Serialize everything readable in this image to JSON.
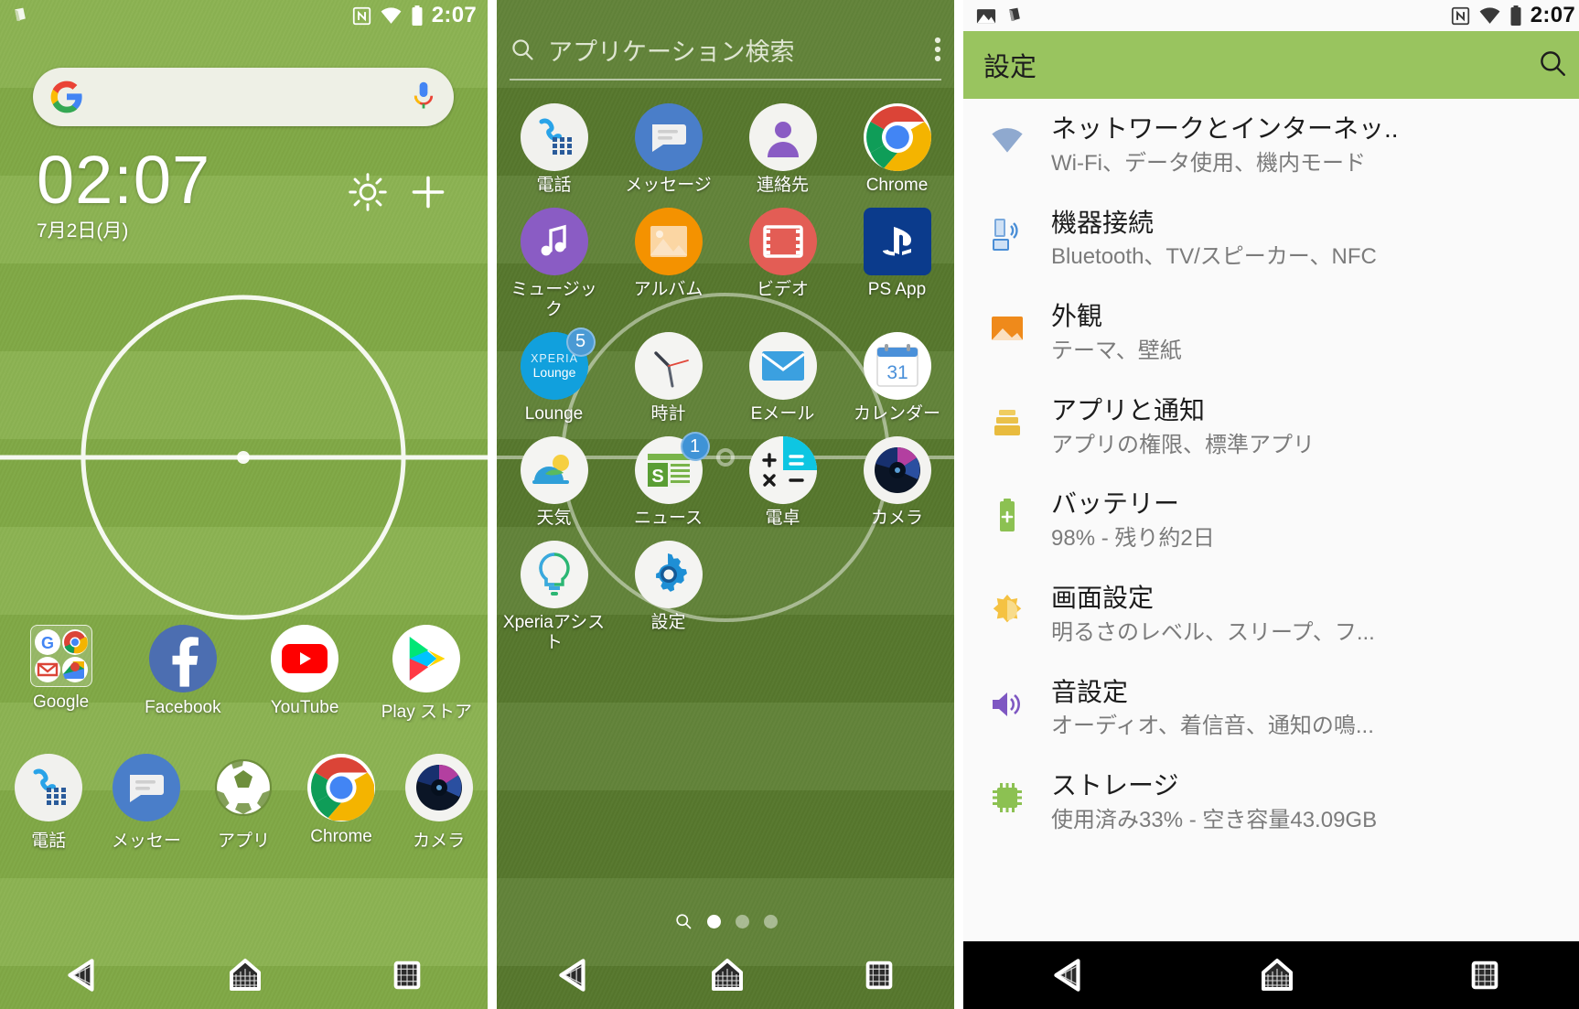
{
  "status_bar": {
    "time": "2:07",
    "icons_right": [
      "nfc-icon",
      "wifi-icon",
      "battery-icon"
    ],
    "icons_left_home": [
      "screenshot-icon"
    ],
    "icons_left_settings": [
      "image-icon",
      "screenshot-icon"
    ]
  },
  "home": {
    "search": {
      "placeholder": "",
      "logo": "google-g-icon",
      "mic": "microphone-icon"
    },
    "clock": {
      "time": "02:07",
      "date": "7月2日(月)",
      "weather_icon": "sun-icon",
      "add_icon": "plus-icon"
    },
    "apps": [
      {
        "label": "Google",
        "icon": "google-folder-icon"
      },
      {
        "label": "Facebook",
        "icon": "facebook-icon"
      },
      {
        "label": "YouTube",
        "icon": "youtube-icon"
      },
      {
        "label": "Play ストア",
        "icon": "play-store-icon"
      }
    ],
    "dock": [
      {
        "label": "電話",
        "icon": "phone-icon"
      },
      {
        "label": "メッセー",
        "icon": "messages-icon"
      },
      {
        "label": "アプリ",
        "icon": "soccer-ball-icon"
      },
      {
        "label": "Chrome",
        "icon": "chrome-icon"
      },
      {
        "label": "カメラ",
        "icon": "camera-icon"
      }
    ]
  },
  "drawer": {
    "search_placeholder": "アプリケーション検索",
    "search_icon": "search-icon",
    "overflow_icon": "more-vertical-icon",
    "page_indicator": {
      "search_icon": "search-icon",
      "dots": 3,
      "active": 0
    },
    "rows": [
      [
        {
          "label": "電話",
          "icon": "phone-icon",
          "badge": ""
        },
        {
          "label": "メッセージ",
          "icon": "messages-icon",
          "badge": ""
        },
        {
          "label": "連絡先",
          "icon": "contacts-icon",
          "badge": ""
        },
        {
          "label": "Chrome",
          "icon": "chrome-icon",
          "badge": ""
        }
      ],
      [
        {
          "label": "ミュージック",
          "icon": "music-icon",
          "badge": ""
        },
        {
          "label": "アルバム",
          "icon": "album-icon",
          "badge": ""
        },
        {
          "label": "ビデオ",
          "icon": "video-icon",
          "badge": ""
        },
        {
          "label": "PS App",
          "icon": "playstation-icon",
          "badge": ""
        }
      ],
      [
        {
          "label": "Lounge",
          "icon": "xperia-lounge-icon",
          "badge": "5"
        },
        {
          "label": "時計",
          "icon": "clock-icon",
          "badge": ""
        },
        {
          "label": "Eメール",
          "icon": "email-icon",
          "badge": ""
        },
        {
          "label": "カレンダー",
          "icon": "calendar-icon",
          "badge": ""
        }
      ],
      [
        {
          "label": "天気",
          "icon": "weather-icon",
          "badge": ""
        },
        {
          "label": "ニュース",
          "icon": "news-suite-icon",
          "badge": "1"
        },
        {
          "label": "電卓",
          "icon": "calculator-icon",
          "badge": ""
        },
        {
          "label": "カメラ",
          "icon": "camera-icon",
          "badge": ""
        }
      ],
      [
        {
          "label": "Xperiaアシスト",
          "icon": "lightbulb-icon",
          "badge": ""
        },
        {
          "label": "設定",
          "icon": "settings-gear-icon",
          "badge": ""
        }
      ]
    ]
  },
  "settings": {
    "title": "設定",
    "search_icon": "search-icon",
    "header_color": "#99c45f",
    "items": [
      {
        "title": "ネットワークとインターネッ..",
        "subtitle": "Wi-Fi、データ使用、機内モード",
        "icon": "wifi-icon",
        "color": "#7f9fd0"
      },
      {
        "title": "機器接続",
        "subtitle": "Bluetooth、TV/スピーカー、NFC",
        "icon": "cast-icon",
        "color": "#5b9bd5"
      },
      {
        "title": "外観",
        "subtitle": "テーマ、壁紙",
        "icon": "appearance-icon",
        "color": "#ef8a1b"
      },
      {
        "title": "アプリと通知",
        "subtitle": "アプリの権限、標準アプリ",
        "icon": "apps-stack-icon",
        "color": "#f2c44d"
      },
      {
        "title": "バッテリー",
        "subtitle": "98% - 残り約2日",
        "icon": "battery-plus-icon",
        "color": "#8cc152"
      },
      {
        "title": "画面設定",
        "subtitle": "明るさのレベル、スリープ、フ...",
        "icon": "brightness-icon",
        "color": "#f5c242"
      },
      {
        "title": "音設定",
        "subtitle": "オーディオ、着信音、通知の鳴...",
        "icon": "volume-icon",
        "color": "#7e57c2"
      },
      {
        "title": "ストレージ",
        "subtitle": "使用済み33% - 空き容量43.09GB",
        "icon": "storage-chip-icon",
        "color": "#8cc152"
      }
    ]
  },
  "navbar": {
    "back": "back-triangle-icon",
    "home": "home-goal-icon",
    "recents": "recents-net-icon"
  },
  "colors": {
    "grass_light": "#85ae48",
    "grass_dark": "#5a7c2f",
    "settings_header": "#99c45f",
    "settings_bg": "#fafafa",
    "badge_blue": "#4a9ad4"
  }
}
